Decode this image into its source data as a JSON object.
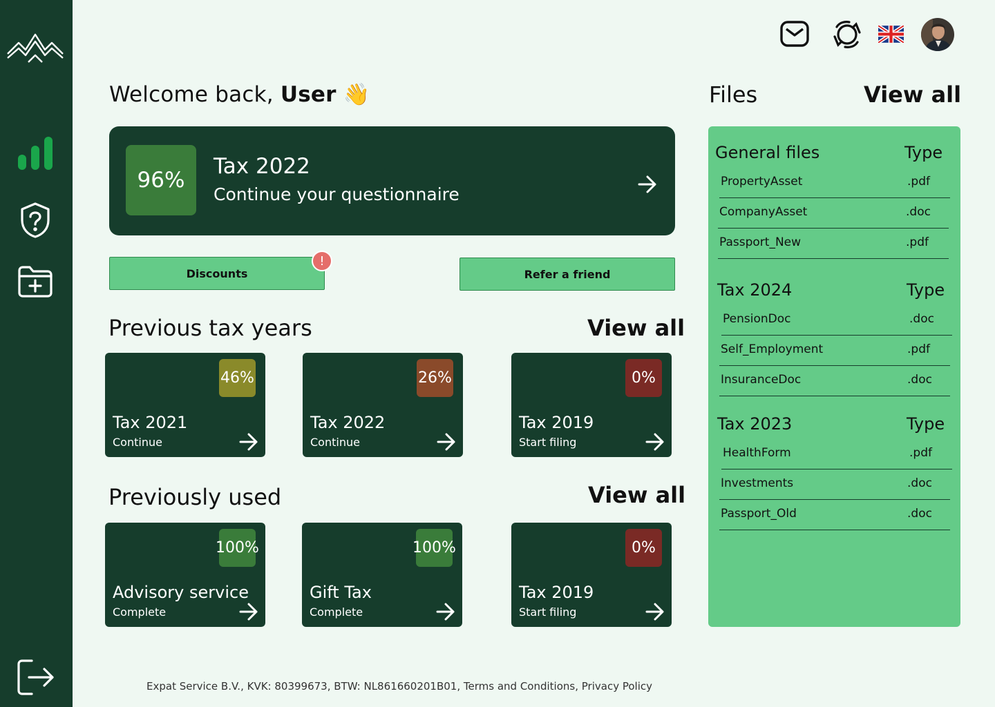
{
  "header": {
    "greeting": "Welcome back,",
    "user_name": "User",
    "wave_emoji": "👋"
  },
  "hero": {
    "percent": "96%",
    "title": "Tax 2022",
    "subtitle": "Continue your questionnaire"
  },
  "actions": {
    "discounts_label": "Discounts",
    "discounts_badge": "!",
    "refer_label": "Refer a friend"
  },
  "previous_tax_years": {
    "title": "Previous tax years",
    "view_all": "View all",
    "cards": [
      {
        "percent": "46%",
        "title": "Tax 2021",
        "subtitle": "Continue",
        "color": "#8a8a2a"
      },
      {
        "percent": "26%",
        "title": "Tax 2022",
        "subtitle": "Continue",
        "color": "#8a4a2a"
      },
      {
        "percent": "0%",
        "title": "Tax 2019",
        "subtitle": "Start filing",
        "color": "#7a2a25"
      }
    ]
  },
  "previously_used": {
    "title": "Previously used",
    "view_all": "View all",
    "cards": [
      {
        "percent": "100%",
        "title": "Advisory service",
        "subtitle": "Complete",
        "color": "#3a7c3a"
      },
      {
        "percent": "100%",
        "title": "Gift Tax",
        "subtitle": "Complete",
        "color": "#3a7c3a"
      },
      {
        "percent": "0%",
        "title": "Tax 2019",
        "subtitle": "Start filing",
        "color": "#7a2a25"
      }
    ]
  },
  "files": {
    "title": "Files",
    "view_all": "View all",
    "groups": [
      {
        "name": "General files",
        "type_label": "Type",
        "items": [
          {
            "name": "PropertyAsset",
            "ext": ".pdf"
          },
          {
            "name": "CompanyAsset",
            "ext": ".doc"
          },
          {
            "name": "Passport_New",
            "ext": ".pdf"
          }
        ]
      },
      {
        "name": "Tax 2024",
        "type_label": "Type",
        "items": [
          {
            "name": "PensionDoc",
            "ext": ".doc"
          },
          {
            "name": "Self_Employment",
            "ext": ".pdf"
          },
          {
            "name": "InsuranceDoc",
            "ext": ".doc"
          }
        ]
      },
      {
        "name": "Tax 2023",
        "type_label": "Type",
        "items": [
          {
            "name": "HealthForm",
            "ext": ".pdf"
          },
          {
            "name": "Investments",
            "ext": ".doc"
          },
          {
            "name": "Passport_Old",
            "ext": ".doc"
          }
        ]
      }
    ]
  },
  "footer": {
    "company": "Expat Service B.V., KVK: 80399673, BTW: NL861660201B01,",
    "terms": "Terms and Conditions,",
    "privacy": "Privacy Policy"
  },
  "icons": {
    "logo": "mountains-logo",
    "nav": [
      "bar-chart-icon",
      "shield-question-icon",
      "folder-plus-icon"
    ],
    "logout": "logout-icon",
    "top": [
      "mail-icon",
      "support-icon",
      "uk-flag-icon",
      "avatar"
    ]
  },
  "colors": {
    "sidebar": "#163d2c",
    "accent_green": "#64cb88",
    "background": "#eff8f2",
    "badge_red": "#e56e6a"
  }
}
